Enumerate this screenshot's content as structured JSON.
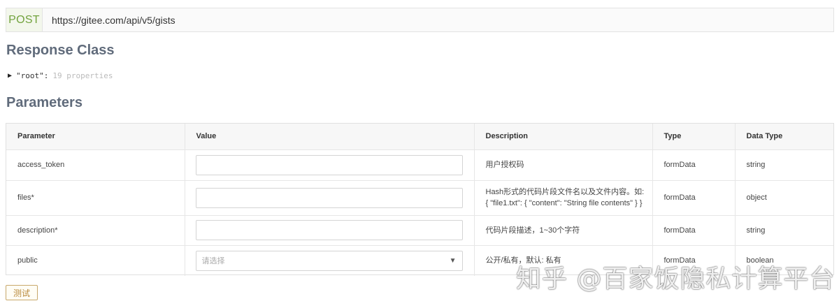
{
  "endpoint": {
    "method": "POST",
    "url": "https://gitee.com/api/v5/gists"
  },
  "response_class": {
    "title": "Response Class",
    "root_key": "\"root\":",
    "root_summary": "19 properties"
  },
  "parameters": {
    "title": "Parameters",
    "headers": [
      "Parameter",
      "Value",
      "Description",
      "Type",
      "Data Type"
    ],
    "rows": [
      {
        "name": "access_token",
        "description": "用户授权码",
        "type": "formData",
        "data_type": "string"
      },
      {
        "name": "files*",
        "description": "Hash形式的代码片段文件名以及文件内容。如: { \"file1.txt\": { \"content\": \"String file contents\" } }",
        "type": "formData",
        "data_type": "object"
      },
      {
        "name": "description*",
        "description": "代码片段描述，1~30个字符",
        "type": "formData",
        "data_type": "string"
      },
      {
        "name": "public",
        "description": "公开/私有，默认: 私有",
        "type": "formData",
        "data_type": "boolean",
        "select_placeholder": "请选择"
      }
    ]
  },
  "test_button": "测试",
  "watermark": "知乎 @百家饭隐私计算平台"
}
